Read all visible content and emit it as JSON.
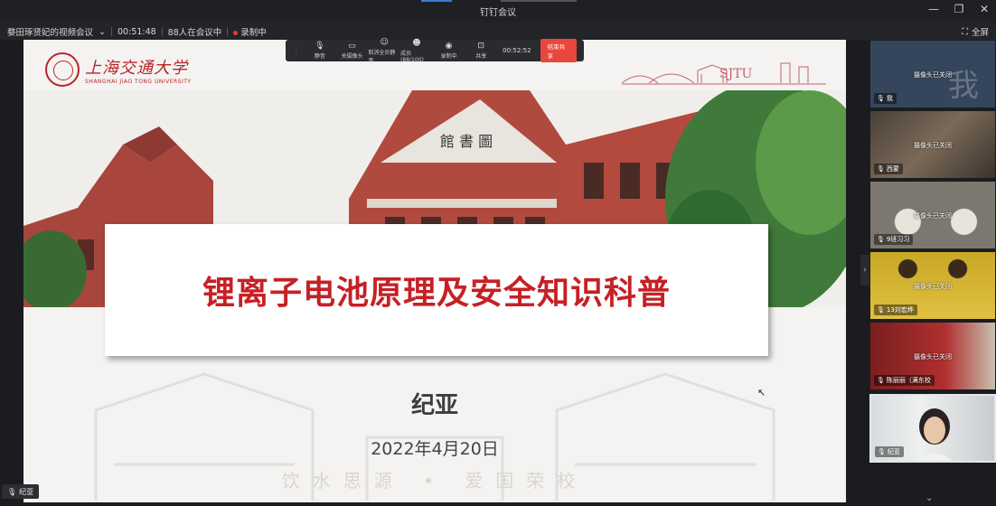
{
  "window": {
    "title": "钉钉会议",
    "controls": [
      "minimize-icon",
      "restore-icon",
      "close-icon"
    ]
  },
  "infobar": {
    "meeting_name": "婺田琢贤妃的视频会议",
    "elapsed": "00:51:48",
    "participants": "88人在会议中",
    "recording": "录制中",
    "fullscreen_label": "全屏"
  },
  "toolbar": {
    "items": [
      {
        "label": "静音",
        "icon": "mic-icon"
      },
      {
        "label": "关摄像头",
        "icon": "camera-icon"
      },
      {
        "label": "取消全员静音",
        "icon": "mute-all-icon"
      },
      {
        "label": "成员(88/100)",
        "icon": "members-icon"
      },
      {
        "label": "录制中",
        "icon": "record-icon"
      },
      {
        "label": "共享",
        "icon": "share-icon"
      }
    ],
    "share_timer": "00:52:52",
    "end_share_label": "结束共享"
  },
  "slide": {
    "university_cn": "上海交通大学",
    "university_en": "SHANGHAI JIAO TONG UNIVERSITY",
    "sjtu_mark": "SJTU",
    "title": "锂离子电池原理及安全知识科普",
    "presenter": "纪亚",
    "date": "2022年4月20日",
    "motto": "饮水思源 • 爱国荣校",
    "colors": {
      "brand_red": "#c62025",
      "seal_red": "#b8262b"
    }
  },
  "sidebar": {
    "tiles": [
      {
        "name": "我",
        "camera": "摄像头已关闭",
        "bg": "#3b4b60"
      },
      {
        "name": "西蒙",
        "camera": "摄像头已关闭",
        "bg": "#6b5a4a"
      },
      {
        "name": "9班习习",
        "camera": "摄像头已关闭",
        "bg": "#8a857c"
      },
      {
        "name": "13刘宏烨",
        "camera": "摄像头已关闭",
        "bg": "#b8a23a"
      },
      {
        "name": "陈丽丽（满东校",
        "camera": "摄像头已关闭",
        "bg": "#8a2a2a"
      },
      {
        "name": "纪亚",
        "camera": "",
        "bg": "#cfd3d6"
      }
    ]
  },
  "presenter_badge": "纪亚"
}
